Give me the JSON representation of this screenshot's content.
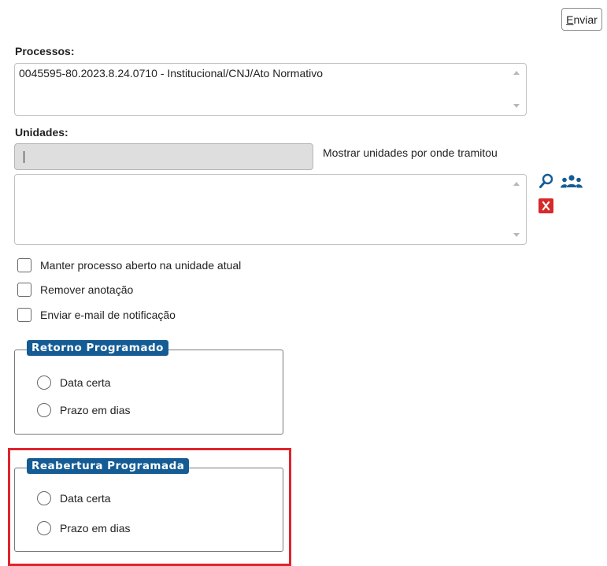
{
  "toolbar": {
    "send_label_underlined": "E",
    "send_label_rest": "nviar"
  },
  "processos": {
    "label": "Processos:",
    "items": [
      "0045595-80.2023.8.24.0710 - Institucional/CNJ/Ato Normativo"
    ]
  },
  "unidades": {
    "label": "Unidades:",
    "input_value": "",
    "show_units_link": "Mostrar unidades por onde tramitou"
  },
  "icons": {
    "search": "search-icon",
    "group": "group-users-icon",
    "remove": "remove-x-icon",
    "accent_blue": "#155c94",
    "remove_red": "#d62a2a",
    "highlight_red": "#e0242c"
  },
  "options": {
    "keep_open": "Manter processo aberto na unidade atual",
    "remove_annotation": "Remover anotação",
    "send_email": "Enviar e-mail de notificação"
  },
  "retorno": {
    "legend": "Retorno Programado",
    "option_date": "Data certa",
    "option_days": "Prazo em dias"
  },
  "reabertura": {
    "legend": "Reabertura Programada",
    "option_date": "Data certa",
    "option_days": "Prazo em dias"
  }
}
